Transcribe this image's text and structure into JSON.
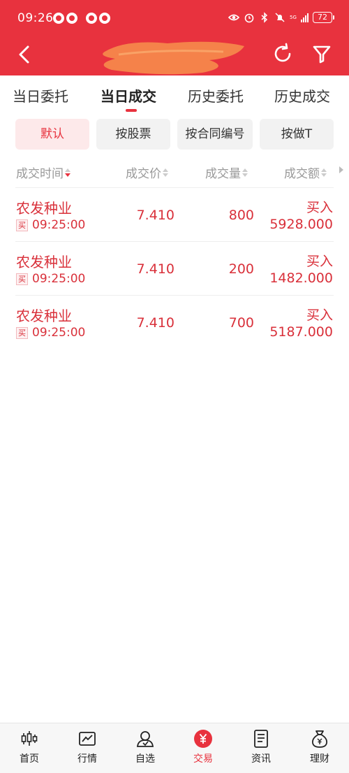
{
  "status_bar": {
    "time": "09:26",
    "network": "5G",
    "battery": "72"
  },
  "header": {
    "back_label": "<",
    "title": ""
  },
  "tabs": [
    {
      "label": "当日委托"
    },
    {
      "label": "当日成交"
    },
    {
      "label": "历史委托"
    },
    {
      "label": "历史成交"
    }
  ],
  "chips": [
    {
      "label": "默认"
    },
    {
      "label": "按股票"
    },
    {
      "label": "按合同编号"
    },
    {
      "label": "按做T"
    }
  ],
  "columns": [
    "成交时间",
    "成交价",
    "成交量",
    "成交额"
  ],
  "rows": [
    {
      "name": "农发种业",
      "side": "买",
      "time": "09:25:00",
      "price": "7.410",
      "qty": "800",
      "action": "买入",
      "amount": "5928.000"
    },
    {
      "name": "农发种业",
      "side": "买",
      "time": "09:25:00",
      "price": "7.410",
      "qty": "200",
      "action": "买入",
      "amount": "1482.000"
    },
    {
      "name": "农发种业",
      "side": "买",
      "time": "09:25:00",
      "price": "7.410",
      "qty": "700",
      "action": "买入",
      "amount": "5187.000"
    }
  ],
  "bottom_nav": [
    {
      "label": "首页",
      "icon": "candlestick-icon"
    },
    {
      "label": "行情",
      "icon": "line-chart-icon"
    },
    {
      "label": "自选",
      "icon": "user-icon"
    },
    {
      "label": "交易",
      "icon": "yen-coin-icon"
    },
    {
      "label": "资讯",
      "icon": "document-icon"
    },
    {
      "label": "理财",
      "icon": "money-bag-icon"
    }
  ],
  "colors": {
    "brand": "#e8323e",
    "text_red": "#d9303a",
    "muted": "#999999"
  }
}
